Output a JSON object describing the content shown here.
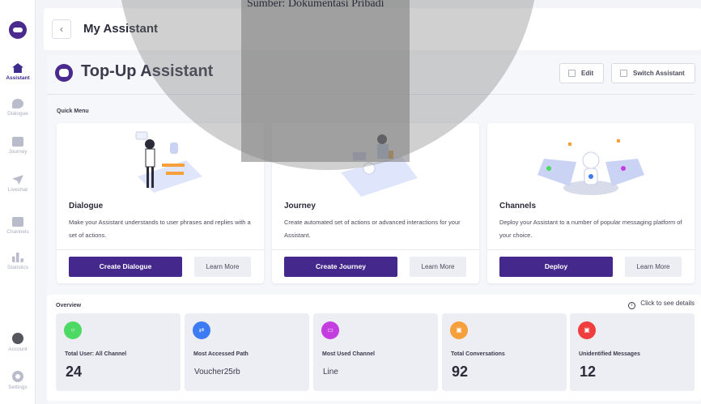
{
  "watermark": "Sumber: Dokumentasi Pribadi",
  "header": {
    "back_icon": "‹",
    "title": "My Assistant"
  },
  "sidebar": {
    "items": [
      {
        "label": "Assistant",
        "icon": "home-icon"
      },
      {
        "label": "Dialogue",
        "icon": "chat-bubble-icon"
      },
      {
        "label": "Journey",
        "icon": "journey-icon"
      },
      {
        "label": "Livechat",
        "icon": "send-icon"
      },
      {
        "label": "Channels",
        "icon": "channels-icon"
      },
      {
        "label": "Statistics",
        "icon": "bar-chart-icon"
      },
      {
        "label": "Account",
        "icon": "avatar-icon"
      },
      {
        "label": "Settings",
        "icon": "gear-icon"
      }
    ]
  },
  "assistant": {
    "title": "Top-Up Assistant",
    "edit_label": "Edit",
    "switch_label": "Switch Assistant"
  },
  "quick_menu": {
    "label": "Quick Menu",
    "cards": [
      {
        "title": "Dialogue",
        "description": "Make your Assistant understands to user phrases and replies with a set of actions.",
        "primary": "Create Dialogue",
        "secondary": "Learn More"
      },
      {
        "title": "Journey",
        "description": "Create automated set of actions or advanced interactions for your Assistant.",
        "primary": "Create Journey",
        "secondary": "Learn More"
      },
      {
        "title": "Channels",
        "description": "Deploy your Assistant to a number of popular messaging platform of your choice.",
        "primary": "Deploy",
        "secondary": "Learn More"
      }
    ]
  },
  "overview": {
    "label": "Overview",
    "hint": "Click to see details",
    "stats": [
      {
        "label": "Total User: All Channel",
        "value": "24",
        "color": "#4cd964"
      },
      {
        "label": "Most Accessed Path",
        "value": "Voucher25rb",
        "color": "#3d7bf5"
      },
      {
        "label": "Most Used Channel",
        "value": "Line",
        "color": "#c43de0"
      },
      {
        "label": "Total Conversations",
        "value": "92",
        "color": "#f5a03d"
      },
      {
        "label": "Unidentified Messages",
        "value": "12",
        "color": "#f03d3d"
      }
    ]
  }
}
